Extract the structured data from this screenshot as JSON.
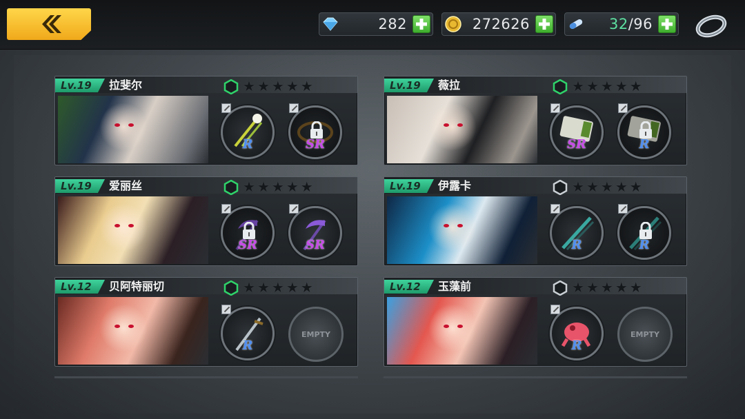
{
  "resources": {
    "gems": "282",
    "gold": "272626",
    "stamina_current": "32",
    "stamina_sep": "/96"
  },
  "colors": {
    "level_badge": "#2fbf87",
    "rarity_R": "#4f8ef0",
    "rarity_SR": "#c74ae8",
    "back_button": "#f5b320",
    "plus_button": "#4fc03a"
  },
  "characters": [
    {
      "level": "Lv.19",
      "name": "拉斐尔",
      "hex_active": true,
      "slots": [
        {
          "type": "weapon",
          "rarity": "R",
          "locked": false,
          "icon": "staff-icon"
        },
        {
          "type": "weapon",
          "rarity": "SR",
          "locked": true,
          "icon": "chain-icon"
        }
      ]
    },
    {
      "level": "Lv.19",
      "name": "薇拉",
      "hex_active": true,
      "slots": [
        {
          "type": "weapon",
          "rarity": "SR",
          "locked": false,
          "icon": "coffin-icon"
        },
        {
          "type": "weapon",
          "rarity": "R",
          "locked": true,
          "icon": "coffin-icon"
        }
      ]
    },
    {
      "level": "Lv.19",
      "name": "爱丽丝",
      "hex_active": true,
      "slots": [
        {
          "type": "weapon",
          "rarity": "SR",
          "locked": true,
          "icon": "scythe-icon"
        },
        {
          "type": "weapon",
          "rarity": "SR",
          "locked": false,
          "icon": "scythe-icon"
        }
      ]
    },
    {
      "level": "Lv.19",
      "name": "伊露卡",
      "hex_active": false,
      "slots": [
        {
          "type": "weapon",
          "rarity": "R",
          "locked": false,
          "icon": "gun-icon"
        },
        {
          "type": "weapon",
          "rarity": "R",
          "locked": true,
          "icon": "gun-icon"
        }
      ]
    },
    {
      "level": "Lv.12",
      "name": "贝阿特丽切",
      "hex_active": true,
      "slots": [
        {
          "type": "weapon",
          "rarity": "R",
          "locked": false,
          "icon": "sword-icon"
        },
        {
          "type": "empty",
          "label": "EMPTY"
        }
      ]
    },
    {
      "level": "Lv.12",
      "name": "玉藻前",
      "hex_active": false,
      "slots": [
        {
          "type": "weapon",
          "rarity": "R",
          "locked": false,
          "icon": "creature-icon"
        },
        {
          "type": "empty",
          "label": "EMPTY"
        }
      ]
    }
  ]
}
